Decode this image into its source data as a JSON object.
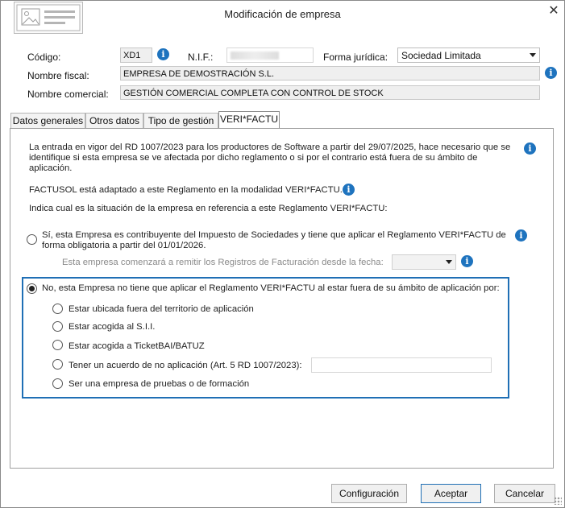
{
  "window": {
    "title": "Modificación de empresa",
    "close_glyph": "✕"
  },
  "header": {
    "codigo_label": "Código:",
    "codigo_value": "XD1",
    "nif_label": "N.I.F.:",
    "nif_value": "",
    "forma_label": "Forma jurídica:",
    "forma_value": "Sociedad Limitada",
    "nombre_fiscal_label": "Nombre fiscal:",
    "nombre_fiscal_value": "EMPRESA DE DEMOSTRACIÓN S.L.",
    "nombre_comercial_label": "Nombre comercial:",
    "nombre_comercial_value": "GESTIÓN COMERCIAL COMPLETA CON CONTROL DE STOCK"
  },
  "tabs": [
    {
      "label": "Datos generales",
      "active": false
    },
    {
      "label": "Otros datos",
      "active": false
    },
    {
      "label": "Tipo de gestión",
      "active": false
    },
    {
      "label": "VERI*FACTU",
      "active": true
    }
  ],
  "verifactu": {
    "intro": "La entrada en vigor del RD 1007/2023 para los productores de Software a partir del 29/07/2025, hace necesario que se identifique si esta empresa se ve afectada por dicho reglamento o si por el contrario está fuera de su ámbito de aplicación.",
    "adapted": "FACTUSOL está adaptado a este Reglamento en la modalidad VERI*FACTU.",
    "indicate": "Indica cual es la situación de la empresa en referencia a este Reglamento VERI*FACTU:",
    "option_yes": "Sí, esta Empresa es contribuyente del Impuesto de Sociedades y tiene que aplicar el Reglamento VERI*FACTU de forma obligatoria a partir del 01/01/2026.",
    "start_date_label": "Esta empresa comenzará a remitir los Registros de Facturación desde la fecha:",
    "start_date_value": "",
    "option_no": "No, esta Empresa no tiene que aplicar el Reglamento VERI*FACTU al estar fuera de su ámbito de aplicación por:",
    "sub_options": [
      "Estar ubicada fuera del territorio de aplicación",
      "Estar acogida al S.I.I.",
      "Estar acogida a TicketBAI/BATUZ",
      "Tener un acuerdo de no aplicación (Art. 5 RD 1007/2023):",
      "Ser una empresa de pruebas o de formación"
    ],
    "acuerdo_value": ""
  },
  "buttons": {
    "config": "Configuración",
    "accept": "Aceptar",
    "cancel": "Cancelar"
  },
  "colors": {
    "accent": "#1f6fb5",
    "info": "#1e73be"
  }
}
